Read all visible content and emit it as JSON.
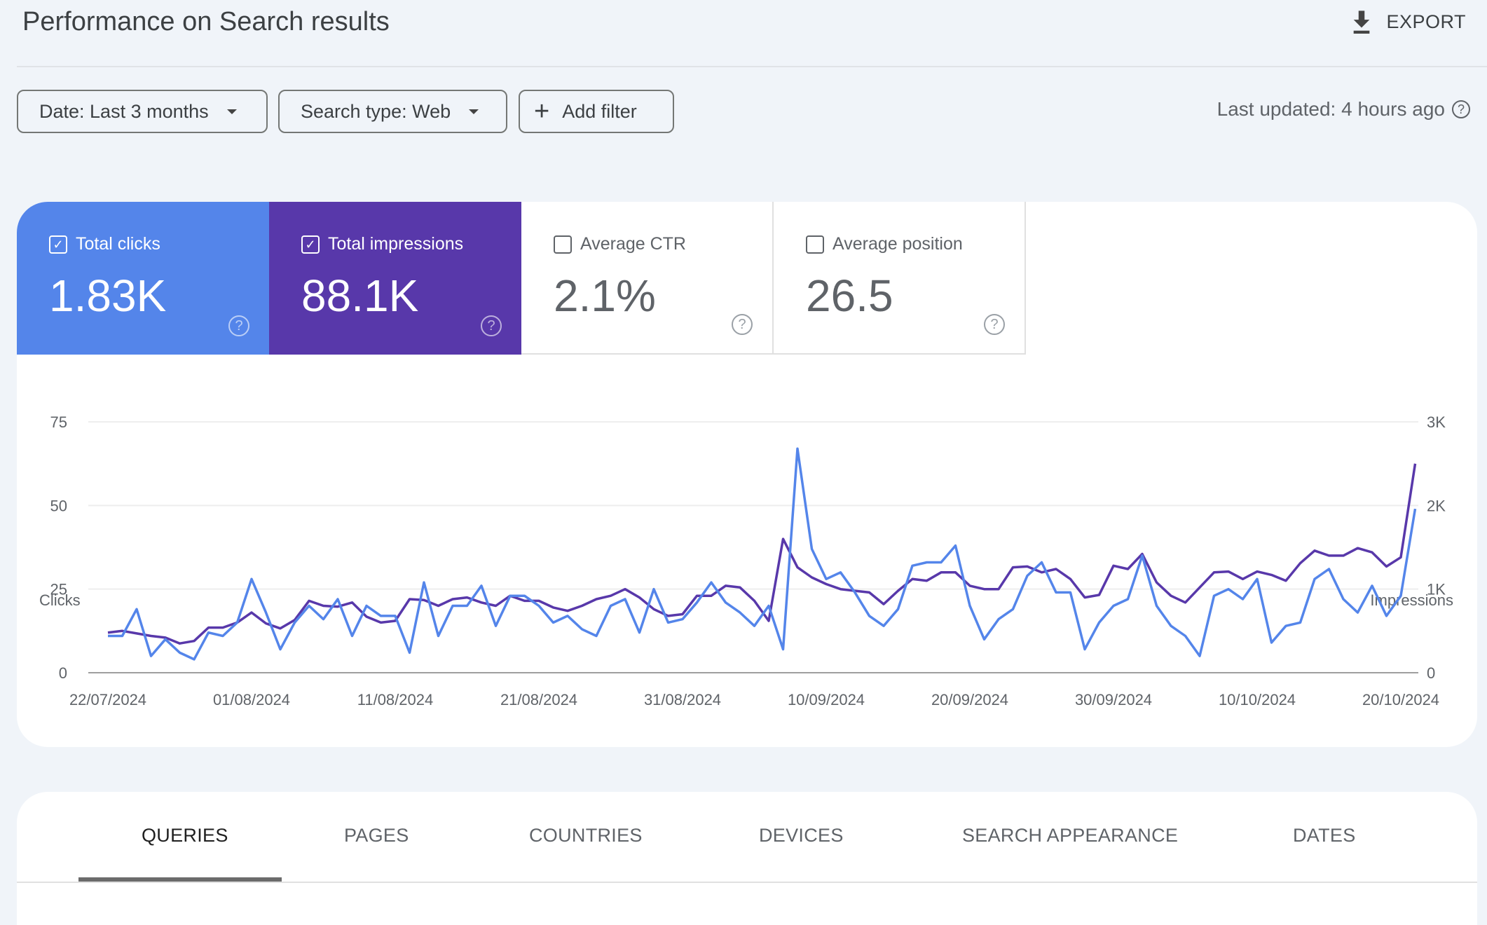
{
  "header": {
    "title": "Performance on Search results",
    "export_label": "EXPORT"
  },
  "filters": {
    "date": "Date: Last 3 months",
    "search_type": "Search type: Web",
    "add_filter": "Add filter",
    "last_updated": "Last updated: 4 hours ago"
  },
  "metrics": [
    {
      "label": "Total clicks",
      "value": "1.83K",
      "checked": true,
      "color": "#5485ea"
    },
    {
      "label": "Total impressions",
      "value": "88.1K",
      "checked": true,
      "color": "#5838aa"
    },
    {
      "label": "Average CTR",
      "value": "2.1%",
      "checked": false
    },
    {
      "label": "Average position",
      "value": "26.5",
      "checked": false
    }
  ],
  "tabs": [
    "QUERIES",
    "PAGES",
    "COUNTRIES",
    "DEVICES",
    "SEARCH APPEARANCE",
    "DATES"
  ],
  "active_tab": "QUERIES",
  "chart_data": {
    "type": "line",
    "title": "",
    "ylabel_left": "Clicks",
    "ylabel_right": "Impressions",
    "ylim_left": [
      0,
      75
    ],
    "ylim_right": [
      0,
      3000
    ],
    "yticks_left": [
      "0",
      "25",
      "50",
      "75"
    ],
    "yticks_right": [
      "0",
      "1K",
      "2K",
      "3K"
    ],
    "xticks": [
      "22/07/2024",
      "01/08/2024",
      "11/08/2024",
      "21/08/2024",
      "31/08/2024",
      "10/09/2024",
      "20/09/2024",
      "30/09/2024",
      "10/10/2024",
      "20/10/2024"
    ],
    "x_start": "22/07/2024",
    "x_end": "21/10/2024",
    "grid": true,
    "series": [
      {
        "name": "Clicks",
        "axis": "left",
        "color": "#5485ea",
        "values": [
          11,
          11,
          19,
          5,
          10,
          6,
          4,
          12,
          11,
          15,
          28,
          18,
          7,
          15,
          20,
          16,
          22,
          11,
          20,
          17,
          17,
          6,
          27,
          11,
          20,
          20,
          26,
          14,
          23,
          23,
          20,
          15,
          17,
          13,
          11,
          20,
          22,
          12,
          25,
          15,
          16,
          21,
          27,
          21,
          18,
          14,
          20,
          7,
          67,
          37,
          28,
          30,
          24,
          17,
          14,
          19,
          32,
          33,
          33,
          38,
          20,
          10,
          16,
          19,
          29,
          33,
          24,
          24,
          7,
          15,
          20,
          22,
          35,
          20,
          14,
          11,
          5,
          23,
          25,
          22,
          28,
          9,
          14,
          15,
          28,
          31,
          22,
          18,
          26,
          17,
          23,
          49
        ]
      },
      {
        "name": "Impressions",
        "axis": "right",
        "color": "#5838aa",
        "values": [
          480,
          500,
          470,
          440,
          420,
          350,
          380,
          540,
          540,
          600,
          720,
          590,
          530,
          630,
          860,
          800,
          790,
          840,
          670,
          600,
          620,
          880,
          870,
          800,
          880,
          900,
          840,
          800,
          920,
          860,
          860,
          780,
          740,
          800,
          880,
          920,
          1000,
          900,
          760,
          680,
          700,
          920,
          920,
          1040,
          1020,
          860,
          620,
          1600,
          1260,
          1140,
          1060,
          1000,
          980,
          960,
          820,
          980,
          1120,
          1100,
          1200,
          1200,
          1040,
          1000,
          1000,
          1260,
          1270,
          1200,
          1240,
          1120,
          900,
          930,
          1280,
          1240,
          1420,
          1080,
          920,
          840,
          1020,
          1200,
          1210,
          1120,
          1210,
          1170,
          1100,
          1310,
          1460,
          1400,
          1400,
          1490,
          1440,
          1270,
          1380,
          2500
        ]
      }
    ]
  }
}
